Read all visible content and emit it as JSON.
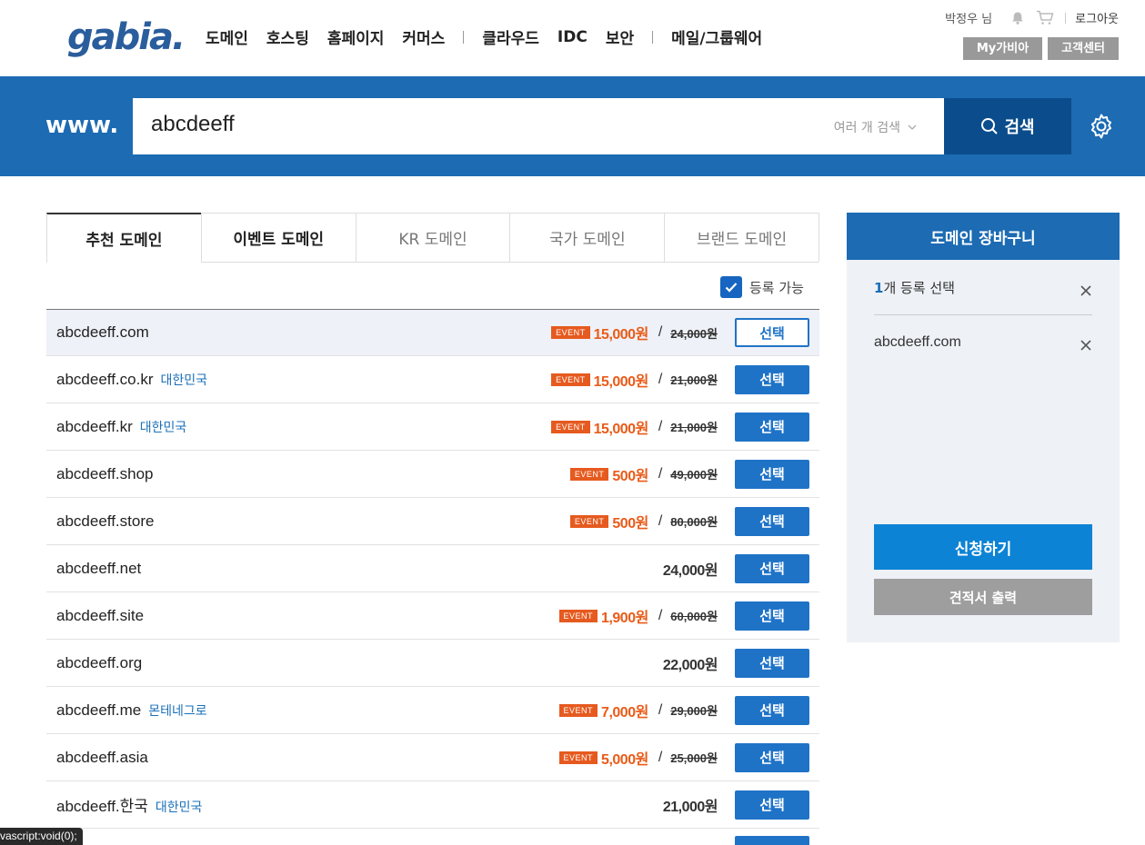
{
  "header": {
    "logo": "gabia.",
    "nav": [
      "도메인",
      "호스팅",
      "홈페이지",
      "커머스",
      "클라우드",
      "IDC",
      "보안",
      "메일/그룹웨어"
    ],
    "user": "박정우 님",
    "logout": "로그아웃",
    "my_gabia": "My가비아",
    "support": "고객센터",
    "icons": [
      "bell-icon",
      "cart-icon"
    ]
  },
  "search": {
    "prefix": "www.",
    "value": "abcdeeff",
    "multi_label": "여러 개 검색",
    "button": "검색"
  },
  "tabs": [
    "추천 도메인",
    "이벤트 도메인",
    "KR 도메인",
    "국가 도메인",
    "브랜드 도메인"
  ],
  "filter": {
    "label": "등록 가능",
    "checked": true
  },
  "event_badge": "EVENT",
  "select_label": "선택",
  "domains": [
    {
      "name": "abcdeeff.com",
      "country": "",
      "event": true,
      "price": "15,000원",
      "orig": "24,000원",
      "selected": true
    },
    {
      "name": "abcdeeff.co.kr",
      "country": "대한민국",
      "event": true,
      "price": "15,000원",
      "orig": "21,000원"
    },
    {
      "name": "abcdeeff.kr",
      "country": "대한민국",
      "event": true,
      "price": "15,000원",
      "orig": "21,000원"
    },
    {
      "name": "abcdeeff.shop",
      "country": "",
      "event": true,
      "price": "500원",
      "orig": "49,000원"
    },
    {
      "name": "abcdeeff.store",
      "country": "",
      "event": true,
      "price": "500원",
      "orig": "80,000원"
    },
    {
      "name": "abcdeeff.net",
      "country": "",
      "event": false,
      "price": "24,000원",
      "orig": ""
    },
    {
      "name": "abcdeeff.site",
      "country": "",
      "event": true,
      "price": "1,900원",
      "orig": "60,000원"
    },
    {
      "name": "abcdeeff.org",
      "country": "",
      "event": false,
      "price": "22,000원",
      "orig": ""
    },
    {
      "name": "abcdeeff.me",
      "country": "몬테네그로",
      "event": true,
      "price": "7,000원",
      "orig": "29,000원"
    },
    {
      "name": "abcdeeff.asia",
      "country": "",
      "event": true,
      "price": "5,000원",
      "orig": "25,000원"
    },
    {
      "name": "abcdeeff.한국",
      "country": "대한민국",
      "event": false,
      "price": "21,000원",
      "orig": ""
    }
  ],
  "cart": {
    "title": "도메인 장바구니",
    "count": "1",
    "count_suffix": "개 등록 선택",
    "item": "abcdeeff.com",
    "apply": "신청하기",
    "quote": "견적서 출력"
  },
  "status_bar": "vascript:void(0);",
  "colors": {
    "brand_blue": "#1c6bb3",
    "search_button": "#0b4d8c",
    "event_orange": "#ea5b18",
    "select_blue": "#1f73c7",
    "apply_blue": "#0d83d5"
  }
}
